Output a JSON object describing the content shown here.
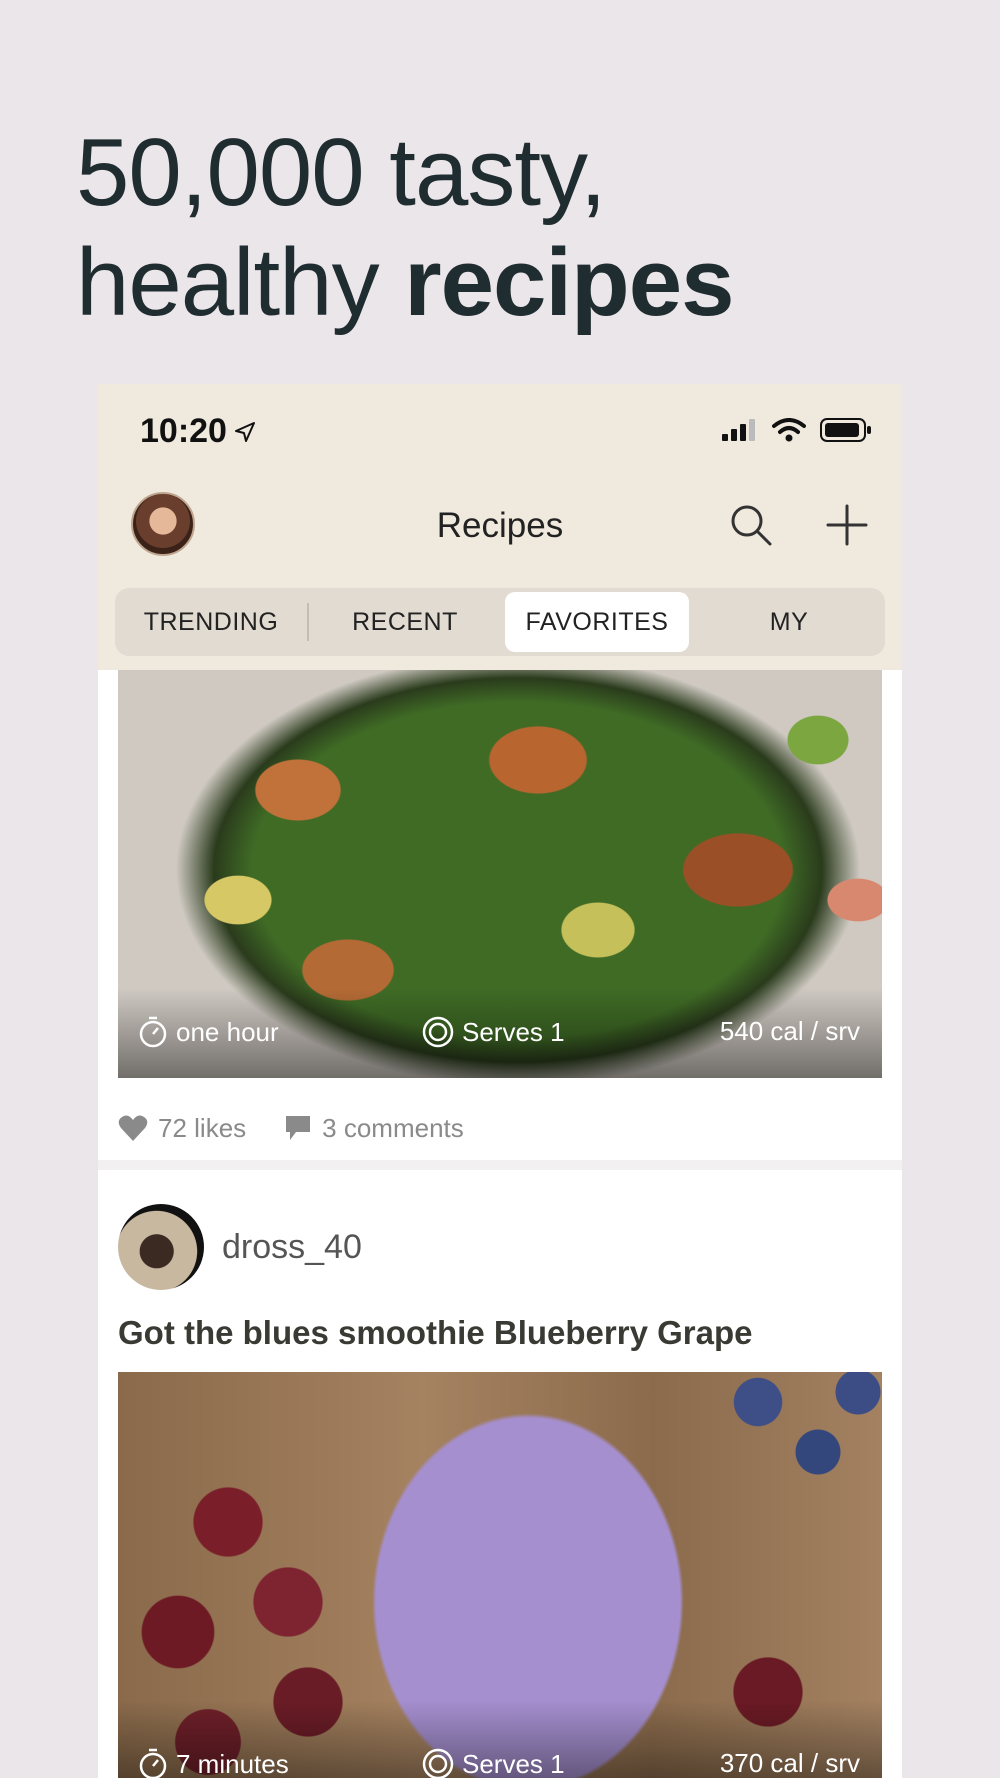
{
  "hero": {
    "line1": "50,000 tasty,",
    "line2_regular": "healthy ",
    "line2_bold": "recipes"
  },
  "status_bar": {
    "time": "10:20",
    "icons": [
      "location-arrow-icon",
      "cellular-signal-icon",
      "wifi-icon",
      "battery-icon"
    ]
  },
  "nav": {
    "title": "Recipes",
    "search_icon": "search-icon",
    "add_icon": "plus-icon"
  },
  "tabs": [
    {
      "label": "TRENDING",
      "active": false
    },
    {
      "label": "RECENT",
      "active": false
    },
    {
      "label": "FAVORITES",
      "active": true
    },
    {
      "label": "MY",
      "active": false
    }
  ],
  "feed": [
    {
      "time": "one hour",
      "serves": "Serves 1",
      "calories": "540 cal / srv",
      "likes": "72 likes",
      "comments": "3 comments"
    },
    {
      "author": "dross_40",
      "title": "Got the blues smoothie Blueberry Grape",
      "time": "7 minutes",
      "serves": "Serves 1",
      "calories": "370 cal / srv"
    }
  ],
  "colors": {
    "page_bg": "#ebe6ea",
    "header_bg": "#efe9de",
    "segment_bg": "#e1dbd1",
    "text_dark": "#1f2c30"
  }
}
